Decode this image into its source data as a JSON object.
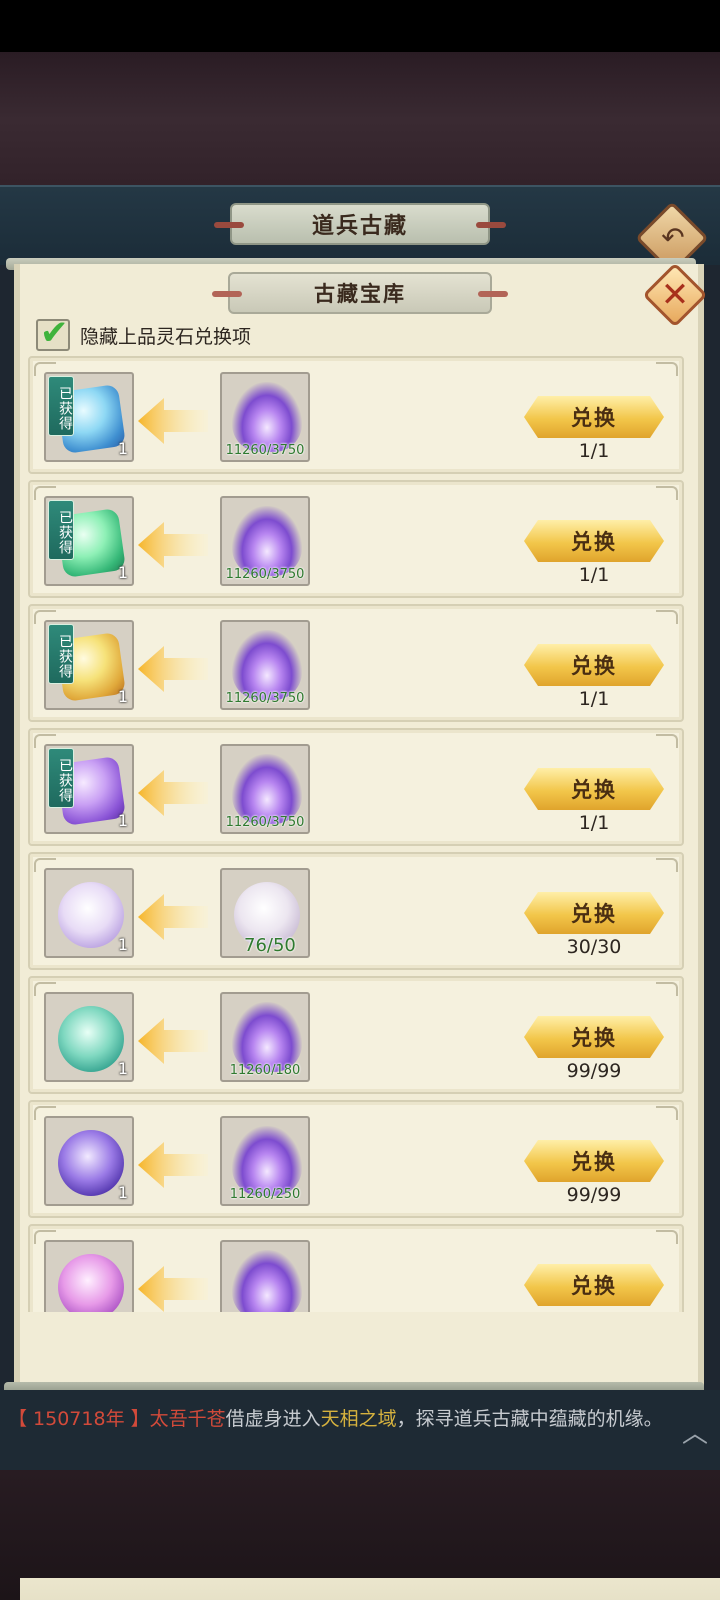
{
  "header": {
    "title": "道兵古藏",
    "back_icon": "back-arrow-icon"
  },
  "panel": {
    "title": "古藏宝库",
    "close_icon": "close-icon"
  },
  "filter": {
    "label": "隐藏上品灵石兑换项",
    "checked": true
  },
  "colors": {
    "accent_gold": "#f2c64a",
    "badge_teal": "#2f8a7a",
    "msg_red": "#d24a3a",
    "msg_gold": "#d6b23e",
    "cost_green": "#2f7a2f"
  },
  "rows": [
    {
      "reward_icon": "blue-spirit-stone-icon",
      "reward_count": "1",
      "badge": "已获得",
      "cost_icon": "purple-flame-icon",
      "cost": "11260/3750",
      "button": "兑换",
      "limit": "1/1"
    },
    {
      "reward_icon": "green-spirit-stone-icon",
      "reward_count": "1",
      "badge": "已获得",
      "cost_icon": "purple-flame-icon",
      "cost": "11260/3750",
      "button": "兑换",
      "limit": "1/1"
    },
    {
      "reward_icon": "yellow-spirit-stone-icon",
      "reward_count": "1",
      "badge": "已获得",
      "cost_icon": "purple-flame-icon",
      "cost": "11260/3750",
      "button": "兑换",
      "limit": "1/1"
    },
    {
      "reward_icon": "purple-spirit-stone-icon",
      "reward_count": "1",
      "badge": "已获得",
      "cost_icon": "purple-flame-icon",
      "cost": "11260/3750",
      "button": "兑换",
      "limit": "1/1"
    },
    {
      "reward_icon": "taiji-orb-icon",
      "reward_count": "1",
      "badge": "",
      "cost_icon": "white-taiji-orb-icon",
      "cost": "76/50",
      "button": "兑换",
      "limit": "30/30"
    },
    {
      "reward_icon": "jade-orb-icon",
      "reward_count": "1",
      "badge": "",
      "cost_icon": "purple-flame-icon",
      "cost": "11260/180",
      "button": "兑换",
      "limit": "99/99"
    },
    {
      "reward_icon": "violet-orb-icon",
      "reward_count": "1",
      "badge": "",
      "cost_icon": "purple-flame-icon",
      "cost": "11260/250",
      "button": "兑换",
      "limit": "99/99"
    },
    {
      "reward_icon": "pink-orb-icon",
      "reward_count": "",
      "badge": "",
      "cost_icon": "purple-flame-icon",
      "cost": "",
      "button": "兑换",
      "limit": ""
    }
  ],
  "message": {
    "year": "【 150718年 】",
    "name": "太吾千苍",
    "part1": "借虚身进入",
    "place": "天相之域",
    "part2": "，探寻道兵古藏中蕴藏的机缘。",
    "expand_icon": "chevron-up-icon"
  }
}
